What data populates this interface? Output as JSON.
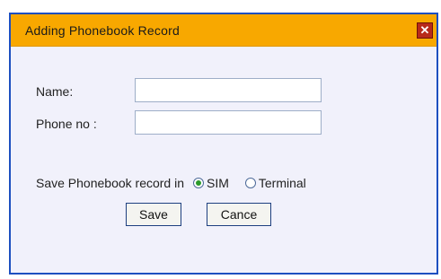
{
  "dialog": {
    "title": "Adding Phonebook Record",
    "close_glyph": "✕",
    "close_icon": "close-icon"
  },
  "form": {
    "name_label": "Name:",
    "name_value": "",
    "phone_label": "Phone no :",
    "phone_value": "",
    "save_in_label": "Save Phonebook record in",
    "options": [
      {
        "label": "SIM",
        "checked": true
      },
      {
        "label": "Terminal",
        "checked": false
      }
    ]
  },
  "buttons": {
    "save_label": "Save",
    "cancel_label": "Cance"
  },
  "colors": {
    "title_bar": "#f8a800",
    "dialog_bg": "#f1f1fb",
    "border": "#1d4fc0",
    "close_bg": "#b82a1a"
  }
}
